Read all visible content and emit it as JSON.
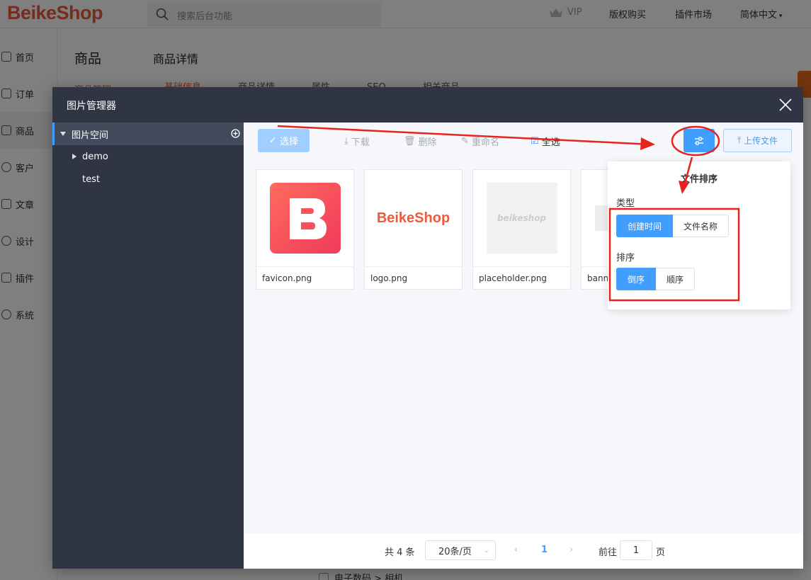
{
  "app": {
    "logo": "BeikeShop",
    "search_placeholder": "搜索后台功能",
    "vip": "VIP",
    "nav": [
      "版权购买",
      "插件市场",
      "简体中文"
    ]
  },
  "sidebar": {
    "items": [
      {
        "label": "首页",
        "icon": "home-icon"
      },
      {
        "label": "订单",
        "icon": "order-icon"
      },
      {
        "label": "商品",
        "icon": "product-icon"
      },
      {
        "label": "客户",
        "icon": "customer-icon"
      },
      {
        "label": "文章",
        "icon": "article-icon"
      },
      {
        "label": "设计",
        "icon": "design-icon"
      },
      {
        "label": "插件",
        "icon": "plugin-icon"
      },
      {
        "label": "系统",
        "icon": "system-icon"
      }
    ]
  },
  "subnav": {
    "title": "商品",
    "sub": "商品管理"
  },
  "content": {
    "title": "商品详情",
    "tabs": [
      "基础信息",
      "商品详情",
      "属性",
      "SEO",
      "相关商品"
    ],
    "category_row": "电子数码 > 相机"
  },
  "dialog": {
    "title": "图片管理器",
    "tree": {
      "root": "图片空间",
      "children": [
        "demo",
        "test"
      ]
    },
    "toolbar": {
      "select": "选择",
      "download": "下载",
      "delete": "删除",
      "rename": "重命名",
      "select_all": "全选",
      "upload": "上传文件"
    },
    "files": [
      {
        "name": "favicon.png"
      },
      {
        "name": "logo.png"
      },
      {
        "name": "placeholder.png",
        "thumb_text": "beikeshop"
      },
      {
        "name": "banner"
      }
    ],
    "logo_thumb_text": "BeikeShop",
    "pager": {
      "total": "共 4 条",
      "size": "20条/页",
      "current": "1",
      "goto_label": "前往",
      "goto_value": "1",
      "page_suffix": "页"
    },
    "sort_popover": {
      "title": "文件排序",
      "type_label": "类型",
      "type_options": [
        "创建时间",
        "文件名称"
      ],
      "order_label": "排序",
      "order_options": [
        "倒序",
        "顺序"
      ]
    }
  },
  "colors": {
    "brand": "#ef5a3c",
    "primary": "#409eff",
    "dialog_dark": "#2f3545",
    "annotation_red": "#e8231c"
  }
}
